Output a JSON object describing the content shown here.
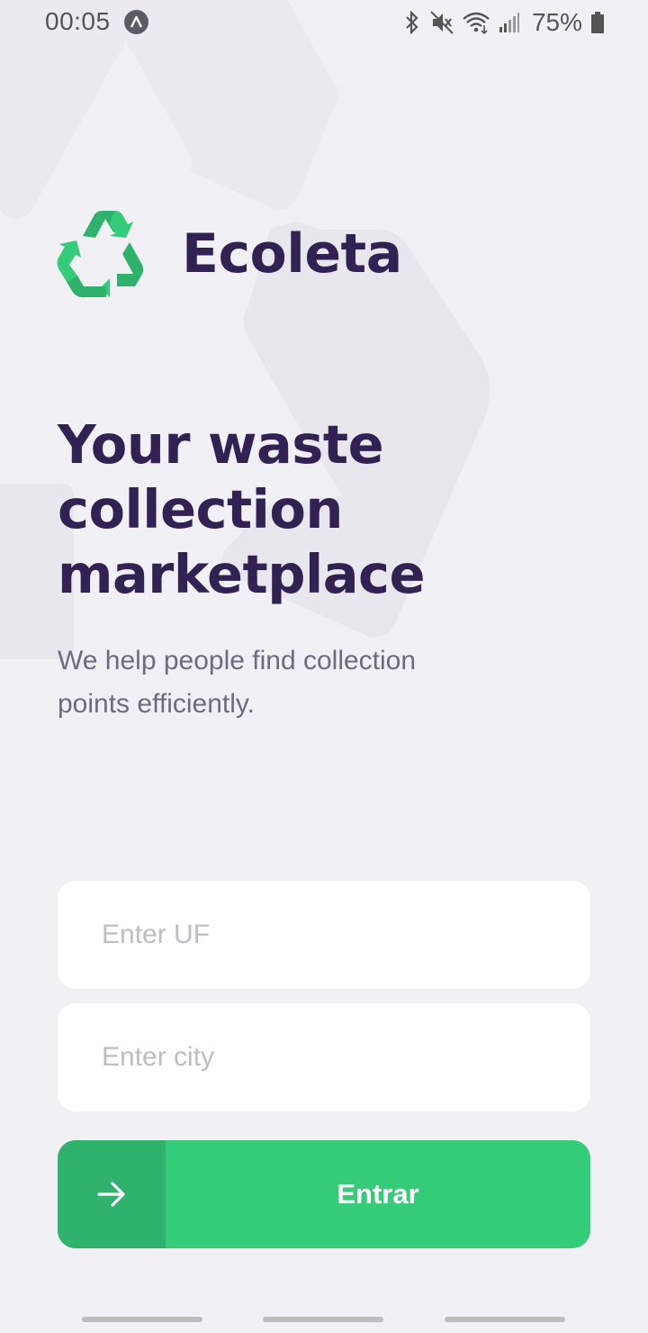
{
  "status_bar": {
    "time": "00:05",
    "battery": "75%",
    "icons": [
      "bluetooth-icon",
      "mute-icon",
      "wifi-icon",
      "signal-icon",
      "battery-icon"
    ]
  },
  "brand": {
    "name": "Ecoleta",
    "logo_icon": "recycle-icon",
    "colors": {
      "primary_green": "#34CB79",
      "dark_green": "#2EB26C",
      "title": "#322153",
      "text": "#6C6C80"
    }
  },
  "hero": {
    "title_lines": [
      "Your waste",
      "collection",
      "marketplace"
    ],
    "subtitle_lines": [
      "We help people find collection",
      "points efficiently."
    ]
  },
  "form": {
    "uf_placeholder": "Enter UF",
    "uf_value": "",
    "city_placeholder": "Enter city",
    "city_value": "",
    "button_label": "Entrar",
    "button_icon": "arrow-right-icon"
  }
}
